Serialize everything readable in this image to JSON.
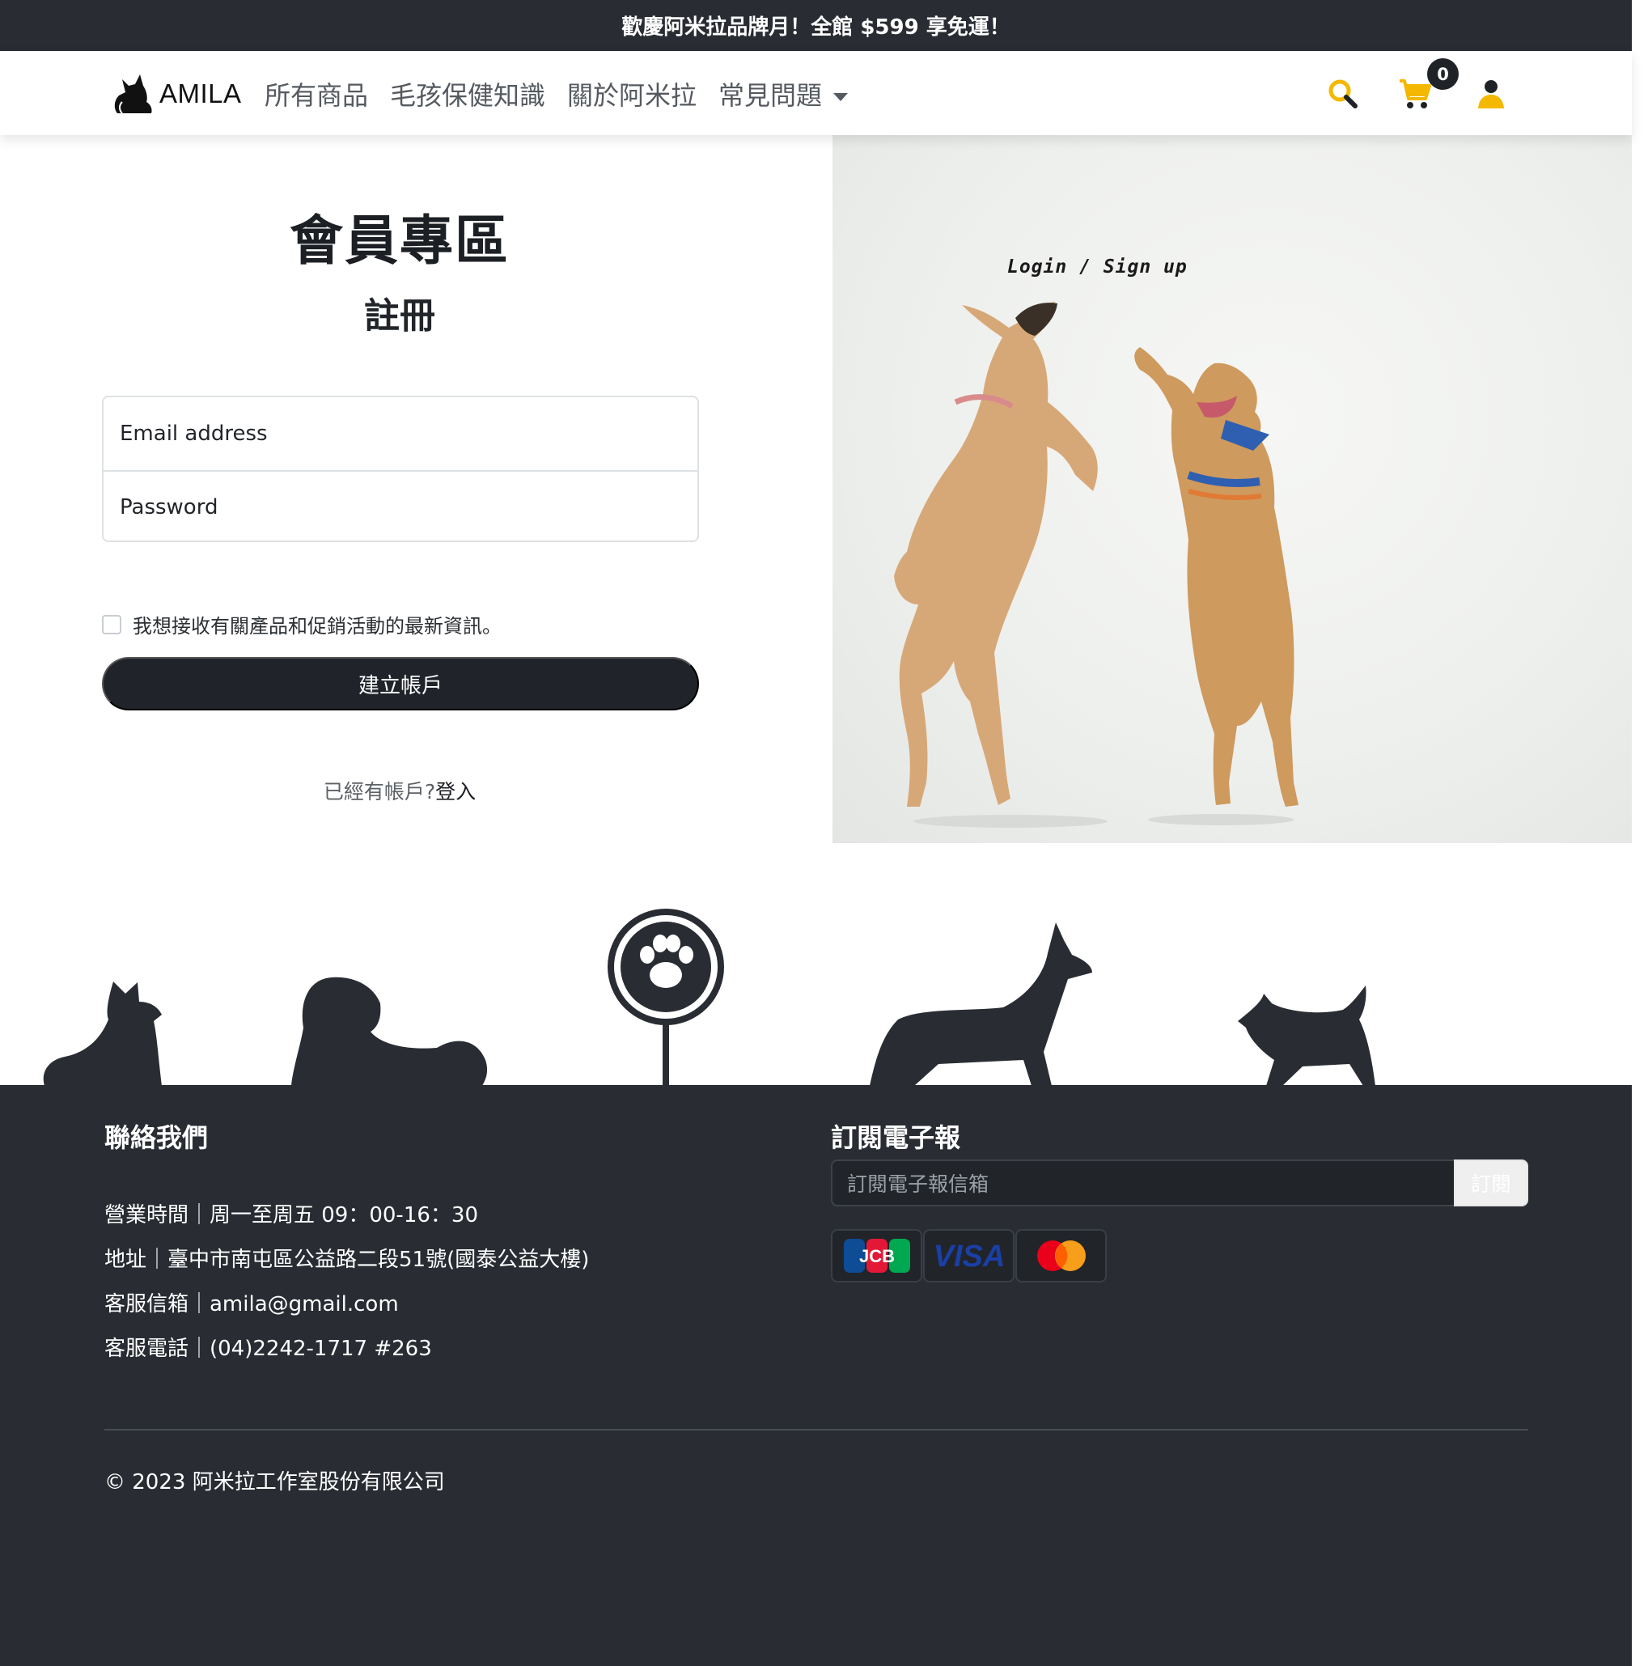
{
  "announcement": "歡慶阿米拉品牌月！全館 $599 享免運！",
  "brand": {
    "name": "AMILA"
  },
  "nav": {
    "links": [
      "所有商品",
      "毛孩保健知識",
      "關於阿米拉",
      "常見問題"
    ],
    "cart_count": "0"
  },
  "auth": {
    "title": "會員專區",
    "subtitle": "註冊",
    "email_placeholder": "Email address",
    "password_placeholder": "Password",
    "newsletter_optin": "我想接收有關產品和促銷活動的最新資訊。",
    "create_button": "建立帳戶",
    "have_account": "已經有帳戶?",
    "login_link": "登入"
  },
  "hero": {
    "caption": "Login / Sign up"
  },
  "footer": {
    "contact_heading": "聯絡我們",
    "hours": "營業時間｜周一至周五 09：00-16：30",
    "address": "地址｜臺中市南屯區公益路二段51號(國泰公益大樓)",
    "email": "客服信箱｜amila@gmail.com",
    "phone": "客服電話｜(04)2242-1717 #263",
    "newsletter_heading": "訂閱電子報",
    "newsletter_placeholder": "訂閱電子報信箱",
    "newsletter_button": "訂閱",
    "payment_cards": [
      "JCB",
      "VISA",
      "Mastercard"
    ],
    "copyright": "© 2023 阿米拉工作室股份有限公司"
  },
  "colors": {
    "dark": "#292d33",
    "accent_icon": "#f5b800",
    "footer_text": "#ffffff"
  }
}
